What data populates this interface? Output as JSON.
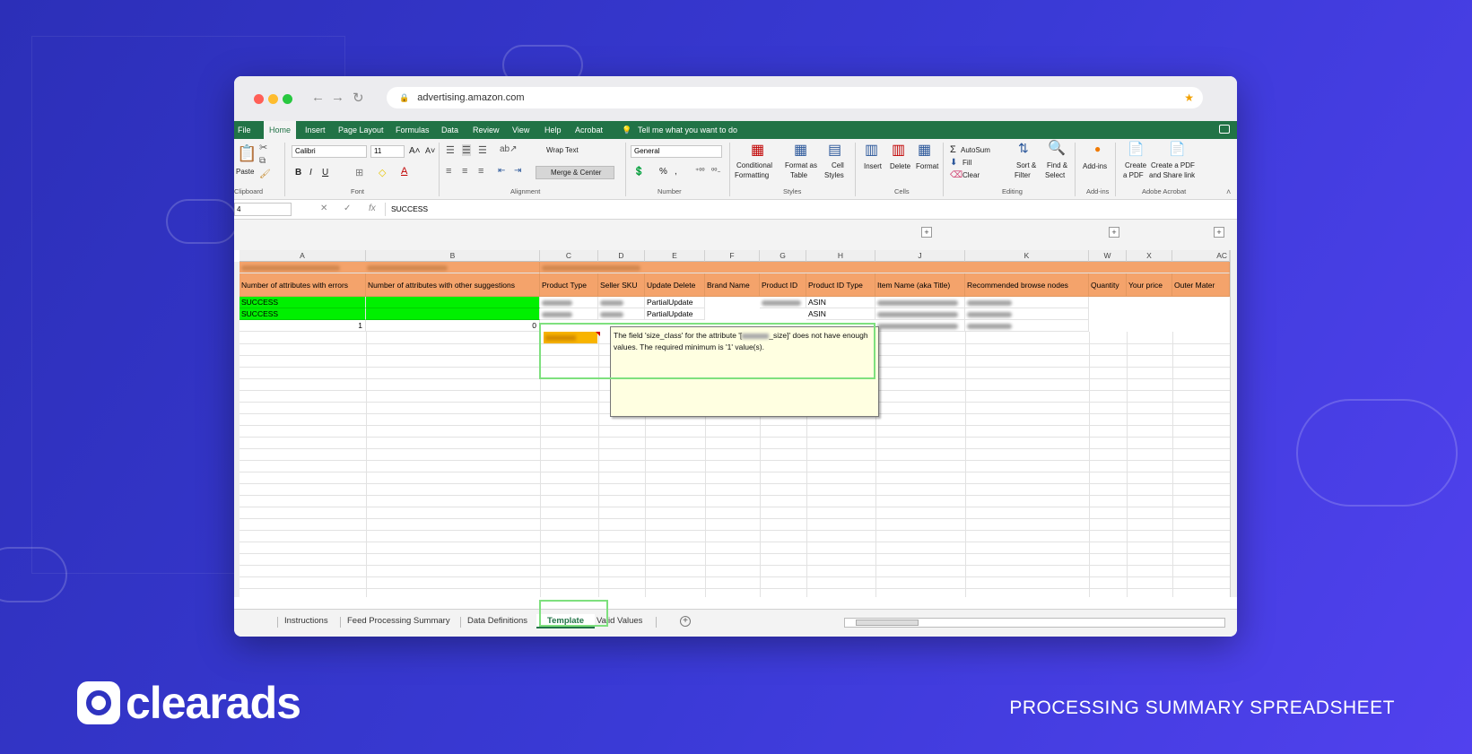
{
  "browser": {
    "url": "advertising.amazon.com"
  },
  "excel": {
    "menu": [
      "File",
      "Home",
      "Insert",
      "Page Layout",
      "Formulas",
      "Data",
      "Review",
      "View",
      "Help",
      "Acrobat"
    ],
    "tell_me": "Tell me what you want to do",
    "ribbon": {
      "paste": "Paste",
      "font_name": "Calibri",
      "font_size": "11",
      "wrap_text": "Wrap Text",
      "merge_center": "Merge & Center",
      "number_format": "General",
      "conditional_formatting": [
        "Conditional",
        "Formatting"
      ],
      "format_as_table": [
        "Format as",
        "Table"
      ],
      "cell_styles": [
        "Cell",
        "Styles"
      ],
      "insert": "Insert",
      "delete": "Delete",
      "format": "Format",
      "autosum": "AutoSum",
      "fill": "Fill",
      "clear": "Clear",
      "sort_filter": [
        "Sort &",
        "Filter"
      ],
      "find_select": [
        "Find &",
        "Select"
      ],
      "add_ins": "Add-ins",
      "create_pdf": [
        "Create",
        "a PDF"
      ],
      "create_share": [
        "Create a PDF",
        "and Share link"
      ],
      "groups": [
        "Clipboard",
        "Font",
        "Alignment",
        "Number",
        "Styles",
        "Cells",
        "Editing",
        "Add-ins",
        "Adobe Acrobat"
      ]
    },
    "namebox": "4",
    "formula_value": "SUCCESS",
    "columns": [
      "A",
      "B",
      "C",
      "D",
      "E",
      "F",
      "G",
      "H",
      "J",
      "K",
      "W",
      "X",
      "AC"
    ],
    "headers": [
      "Number of attributes with errors",
      "Number of attributes with other suggestions",
      "Product Type",
      "Seller SKU",
      "Update Delete",
      "Brand Name",
      "Product ID",
      "Product ID Type",
      "Item Name (aka Title)",
      "Recommended browse nodes",
      "Quantity",
      "Your price",
      "Outer Mater"
    ],
    "rows": [
      {
        "a": "SUCCESS",
        "b": "",
        "e": "PartialUpdate",
        "h": "ASIN"
      },
      {
        "a": "SUCCESS",
        "b": "",
        "e": "PartialUpdate",
        "h": "ASIN"
      },
      {
        "a": "1",
        "b": "0"
      }
    ],
    "tooltip": {
      "before": "The field 'size_class' for the attribute '[",
      "after": "_size]' does not have enough values. The required minimum is '1' value(s)."
    },
    "sheet_tabs": [
      "Instructions",
      "Feed Processing Summary",
      "Data Definitions",
      "Template",
      "Valid Values"
    ],
    "active_tab": "Template"
  },
  "branding": {
    "logo_text": "clearads",
    "caption": "PROCESSING SUMMARY SPREADSHEET"
  },
  "colors": {
    "excel_green": "#217346",
    "header_orange": "#f4a36b",
    "success_green": "#00f000",
    "highlight": "#7ee07e"
  }
}
